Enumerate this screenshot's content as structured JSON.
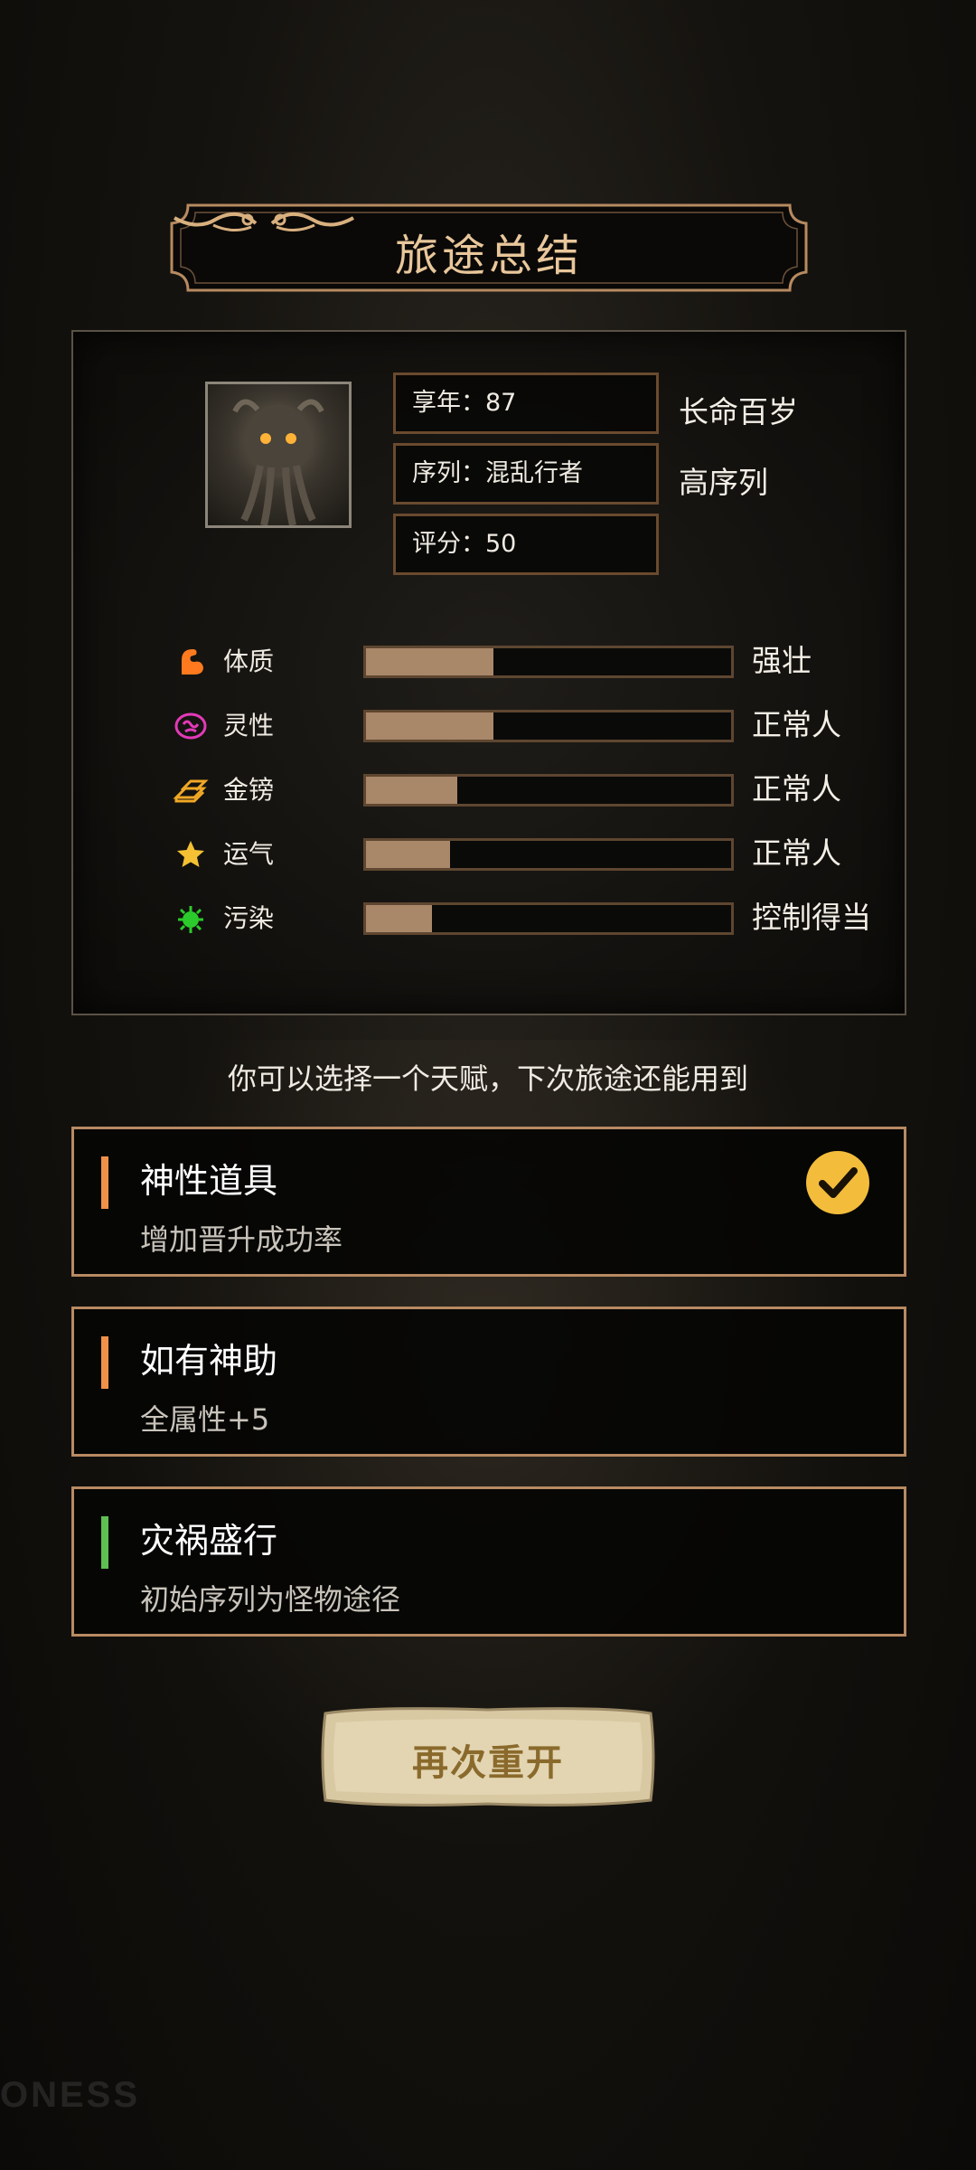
{
  "header": {
    "title": "旅途总结"
  },
  "summary": {
    "avatar_icon": "tentacle-monster-portrait",
    "info": [
      {
        "label": "享年：87",
        "tag": "长命百岁"
      },
      {
        "label": "序列：混乱行者",
        "tag": "高序列"
      },
      {
        "label": "评分：50",
        "tag": ""
      }
    ],
    "stats": [
      {
        "icon": "muscle-arm-icon",
        "name": "体质",
        "value": 0.35,
        "desc": "强壮",
        "color": "#ff7a1f"
      },
      {
        "icon": "brain-icon",
        "name": "灵性",
        "value": 0.35,
        "desc": "正常人",
        "color": "#e23ab8"
      },
      {
        "icon": "gold-bars-icon",
        "name": "金镑",
        "value": 0.25,
        "desc": "正常人",
        "color": "#f0a825"
      },
      {
        "icon": "star-icon",
        "name": "运气",
        "value": 0.23,
        "desc": "正常人",
        "color": "#f3c133"
      },
      {
        "icon": "virus-icon",
        "name": "污染",
        "value": 0.18,
        "desc": "控制得当",
        "color": "#2ccb2c"
      }
    ]
  },
  "prompt": "你可以选择一个天赋，下次旅途还能用到",
  "talents": [
    {
      "name": "神性道具",
      "desc": "增加晋升成功率",
      "accent": "#f0914a",
      "selected": true
    },
    {
      "name": "如有神助",
      "desc": "全属性+5",
      "accent": "#f0914a",
      "selected": false
    },
    {
      "name": "灾祸盛行",
      "desc": "初始序列为怪物途径",
      "accent": "#5fbf53",
      "selected": false
    }
  ],
  "restart_button": {
    "label": "再次重开"
  },
  "watermark": "ONESS"
}
